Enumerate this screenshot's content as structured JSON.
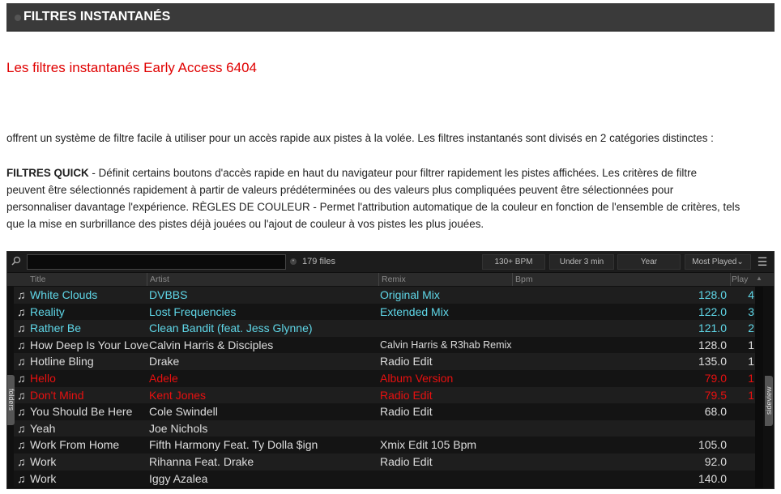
{
  "header": {
    "title": "FILTRES INSTANTANÉS"
  },
  "heading": "Les filtres instantanés Early Access 6404",
  "para1": "offrent un système de filtre facile à utiliser pour un accès rapide aux pistes à la volée. Les filtres instantanés sont divisés en 2 catégories distinctes :",
  "para2_bold": "FILTRES QUICK",
  "para2_lines": [
    " - Définit certains boutons d'accès rapide en haut du navigateur pour filtrer rapidement les pistes affichées. Les critères de filtre",
    "peuvent être sélectionnés rapidement à partir de valeurs prédéterminées ou des valeurs plus compliquées peuvent être sélectionnées pour",
    "personnaliser davantage l'expérience. RÈGLES DE COULEUR - Permet l'attribution automatique de la couleur en fonction de l'ensemble de critères, tels",
    "que la mise en surbrillance des pistes déjà jouées ou l'ajout de couleur à vos pistes les plus jouées."
  ],
  "browser": {
    "search_value": "",
    "files_count": "179 files",
    "quick_filters": [
      "130+ BPM",
      "Under 3 min",
      "Year",
      "Most Played⌄"
    ],
    "columns": {
      "title": "Title",
      "artist": "Artist",
      "remix": "Remix",
      "bpm": "Bpm",
      "play": "Play"
    },
    "folders_tab": "folders",
    "sideview_tab": "sideview",
    "colors": {
      "cyan": "#5fd7e8",
      "white": "#dddddd",
      "red": "#e81010"
    },
    "rows": [
      {
        "title": "White Clouds",
        "artist": "DVBBS",
        "remix": "Original Mix",
        "bpm": "128.0",
        "play": "4",
        "color": "cyan"
      },
      {
        "title": "Reality",
        "artist": "Lost Frequencies",
        "remix": "Extended Mix",
        "bpm": "122.0",
        "play": "3",
        "color": "cyan"
      },
      {
        "title": "Rather Be",
        "artist": "Clean Bandit (feat. Jess Glynne)",
        "remix": "",
        "bpm": "121.0",
        "play": "2",
        "color": "cyan"
      },
      {
        "title": "How Deep Is Your Love",
        "artist": "Calvin Harris & Disciples",
        "remix": "Calvin Harris & R3hab Remix",
        "bpm": "128.0",
        "play": "1",
        "color": "white",
        "small_remix": true
      },
      {
        "title": "Hotline Bling",
        "artist": "Drake",
        "remix": "Radio Edit",
        "bpm": "135.0",
        "play": "1",
        "color": "white"
      },
      {
        "title": "Hello",
        "artist": "Adele",
        "remix": "Album Version",
        "bpm": "79.0",
        "play": "1",
        "color": "red"
      },
      {
        "title": "Don't Mind",
        "artist": "Kent Jones",
        "remix": "Radio Edit",
        "bpm": "79.5",
        "play": "1",
        "color": "red"
      },
      {
        "title": "You Should Be Here",
        "artist": "Cole Swindell",
        "remix": "Radio Edit",
        "bpm": "68.0",
        "play": "",
        "color": "white"
      },
      {
        "title": "Yeah",
        "artist": "Joe Nichols",
        "remix": "",
        "bpm": "",
        "play": "",
        "color": "white"
      },
      {
        "title": "Work From Home",
        "artist": "Fifth Harmony Feat. Ty Dolla $ign",
        "remix": "Xmix Edit 105 Bpm",
        "bpm": "105.0",
        "play": "",
        "color": "white"
      },
      {
        "title": "Work",
        "artist": "Rihanna Feat. Drake",
        "remix": "Radio Edit",
        "bpm": "92.0",
        "play": "",
        "color": "white"
      },
      {
        "title": "Work",
        "artist": "Iggy Azalea",
        "remix": "",
        "bpm": "140.0",
        "play": "",
        "color": "white"
      }
    ]
  }
}
